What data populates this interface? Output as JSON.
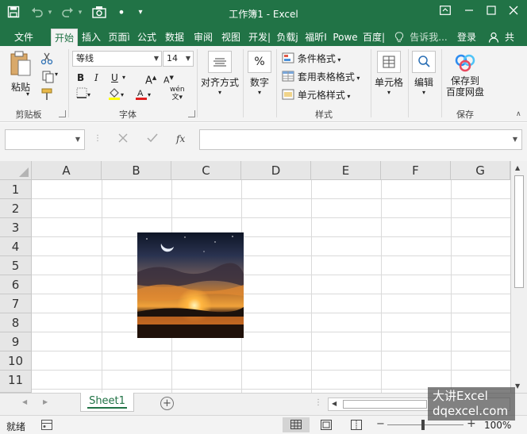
{
  "colors": {
    "accent": "#217346",
    "ribbon_bg": "#f3f3f3",
    "header_bg": "#e6e6e6",
    "grid_line": "#dadada"
  },
  "titlebar": {
    "title": "工作簿1 - Excel",
    "icons": [
      "save-icon",
      "undo-icon",
      "redo-icon",
      "camera-icon",
      "dot-icon",
      "qat-dropdown-icon"
    ],
    "window_icons": [
      "ribbon-display-icon",
      "minimize-icon",
      "maximize-icon",
      "close-icon"
    ]
  },
  "tabs": [
    {
      "label": "文件",
      "active": false
    },
    {
      "label": "开始",
      "active": true
    },
    {
      "label": "插入",
      "active": false
    },
    {
      "label": "页面ì",
      "active": false
    },
    {
      "label": "公式",
      "active": false
    },
    {
      "label": "数据",
      "active": false
    },
    {
      "label": "审阅",
      "active": false
    },
    {
      "label": "视图",
      "active": false
    },
    {
      "label": "开发|",
      "active": false
    },
    {
      "label": "负载j",
      "active": false
    },
    {
      "label": "福昕I",
      "active": false
    },
    {
      "label": "Powe",
      "active": false
    },
    {
      "label": "百度|",
      "active": false
    }
  ],
  "tell_me": "告诉我...",
  "login": "登录",
  "share": "共",
  "ribbon": {
    "clipboard": {
      "label": "剪贴板",
      "paste": "粘贴"
    },
    "font": {
      "label": "字体",
      "name": "等线",
      "size": "14",
      "bold": "B",
      "italic": "I",
      "underline": "U",
      "grow": "A",
      "shrink": "A",
      "phonetic": "wén"
    },
    "alignment": {
      "label": "对齐方式"
    },
    "number": {
      "label": "数字",
      "symbol": "%"
    },
    "styles": {
      "label": "样式",
      "conditional": "条件格式",
      "table": "套用表格格式",
      "cell": "单元格样式"
    },
    "cells": {
      "label": "单元格"
    },
    "editing": {
      "label": "编辑"
    },
    "save": {
      "label": "保存",
      "button_line1": "保存到",
      "button_line2": "百度网盘"
    }
  },
  "formula_bar": {
    "fx": "fx"
  },
  "grid": {
    "columns": [
      "A",
      "B",
      "C",
      "D",
      "E",
      "F",
      "G"
    ],
    "rows": [
      "1",
      "2",
      "3",
      "4",
      "5",
      "6",
      "7",
      "8",
      "9",
      "10",
      "11"
    ]
  },
  "sheets": [
    {
      "name": "Sheet1",
      "active": true
    }
  ],
  "statusbar": {
    "ready": "就绪",
    "zoom": "100%"
  },
  "watermark": {
    "line1": "大讲Excel",
    "line2": "dqexcel.com"
  }
}
